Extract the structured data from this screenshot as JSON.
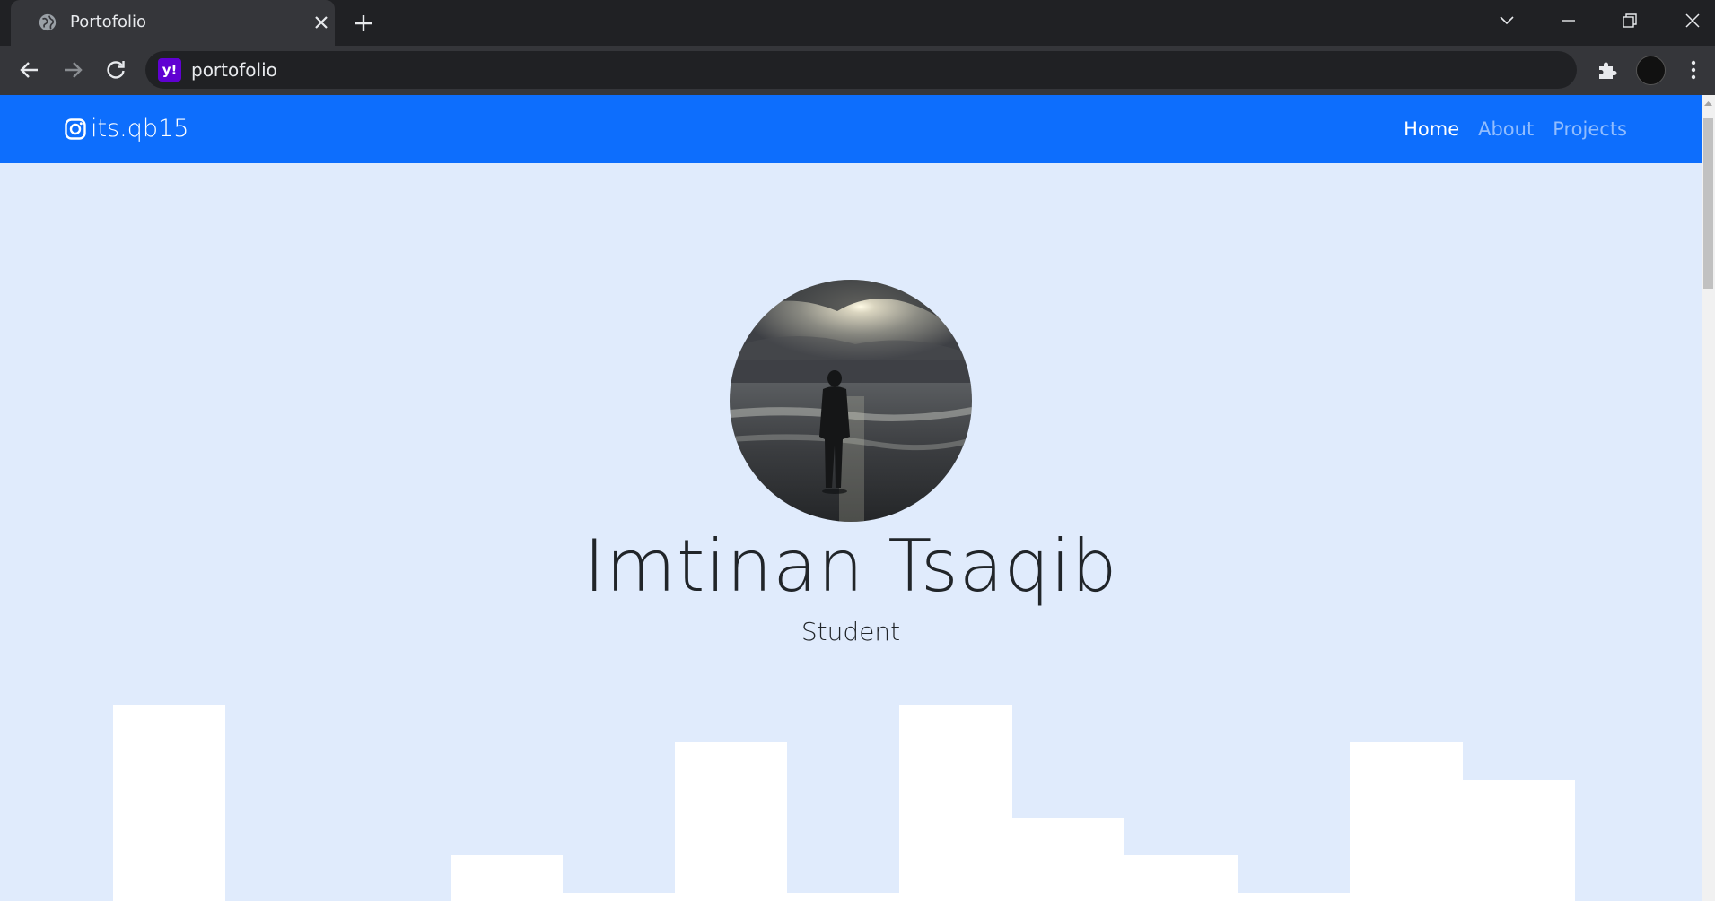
{
  "browser": {
    "tab": {
      "title": "Portofolio"
    },
    "address_bar": {
      "text": "portofolio",
      "site_badge": "y!"
    },
    "icons": {
      "favicon": "globe-icon",
      "close": "close-icon",
      "new_tab": "plus-icon",
      "back": "back-arrow-icon",
      "forward": "forward-arrow-icon",
      "reload": "reload-icon",
      "extensions": "puzzle-icon",
      "menu": "kebab-menu-icon"
    }
  },
  "page": {
    "navbar": {
      "brand": "its.qb15",
      "brand_icon": "instagram-icon",
      "background": "#0d6efd",
      "links": [
        {
          "label": "Home",
          "active": true
        },
        {
          "label": "About",
          "active": false
        },
        {
          "label": "Projects",
          "active": false
        }
      ]
    },
    "hero": {
      "name": "Imtinan Tsaqib",
      "role": "Student",
      "background": "#e0ebfc"
    }
  }
}
